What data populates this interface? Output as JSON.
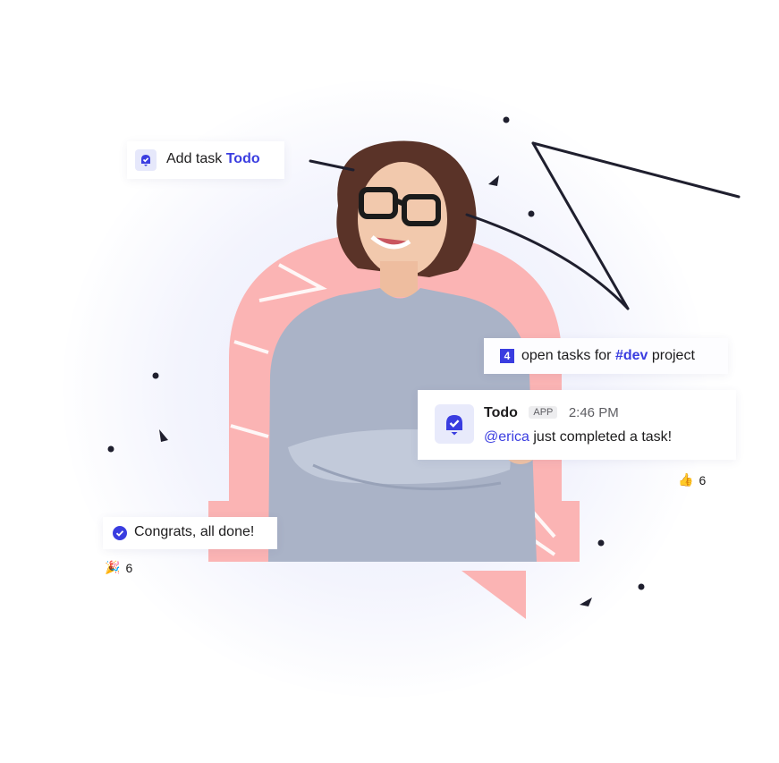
{
  "add_task": {
    "prefix": "Add task",
    "app": "Todo"
  },
  "open_tasks": {
    "count": "4",
    "prefix": "open tasks for",
    "channel": "#dev",
    "suffix": "project"
  },
  "message": {
    "sender": "Todo",
    "tag": "APP",
    "time": "2:46 PM",
    "mention": "@erica",
    "text": "just completed a task!"
  },
  "thumbs_reaction": {
    "emoji": "👍",
    "count": "6"
  },
  "done_message": {
    "text": "Congrats, all done!"
  },
  "party_reaction": {
    "emoji": "🎉",
    "count": "6"
  },
  "icons": [
    "bell-check-icon",
    "check-circle-icon",
    "thumbs-up-icon",
    "party-popper-icon"
  ],
  "colors": {
    "accent": "#3a3de0",
    "arch": "#fbb4b4",
    "sweater": "#a9b2c6",
    "line": "#1f1f2e"
  }
}
